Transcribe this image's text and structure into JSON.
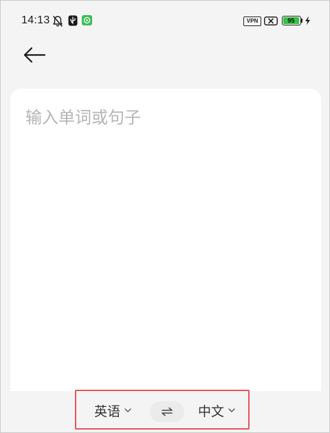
{
  "status_bar": {
    "time": "14:13",
    "vpn_label": "VPN",
    "battery_level": "95",
    "battery_percent": 95,
    "icons": [
      "bell-muted-icon",
      "usb-icon",
      "app-notification-icon",
      "vpn-icon",
      "no-signal-icon",
      "battery-icon",
      "charging-bolt-icon"
    ]
  },
  "header": {
    "back_icon": "arrow-left-icon"
  },
  "input": {
    "placeholder": "输入单词或句子",
    "value": ""
  },
  "language_bar": {
    "source_language": "英语",
    "target_language": "中文",
    "swap_icon": "swap-arrows-icon",
    "highlight_color": "#e8525c"
  },
  "colors": {
    "app_accent_icon": "#3dbd5a",
    "battery_fill": "#36c244"
  }
}
